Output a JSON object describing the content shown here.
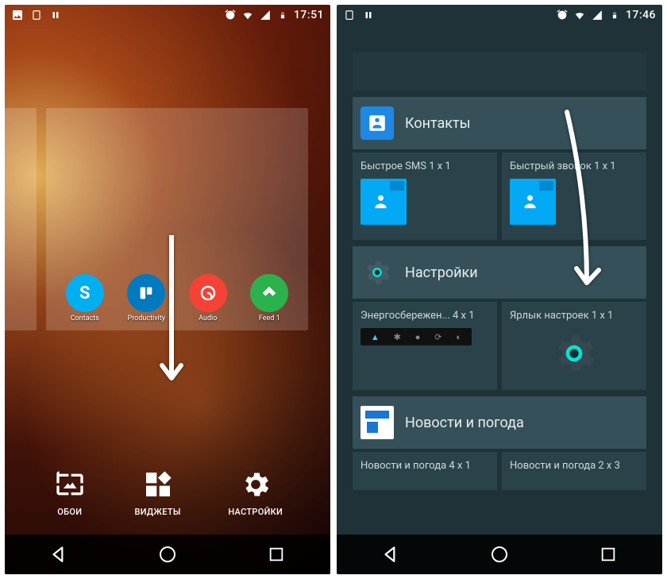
{
  "left": {
    "status": {
      "time": "17:51"
    },
    "apps": [
      {
        "label": "Contacts",
        "bg": "#00aff0",
        "letter": "S"
      },
      {
        "label": "Productivity",
        "bg": "#0079bf",
        "letter": ""
      },
      {
        "label": "Audio",
        "bg": "#f44336",
        "letter": ""
      },
      {
        "label": "Feed 1",
        "bg": "#2bb24c",
        "letter": ""
      }
    ],
    "actions": {
      "wallpaper": "ОБОИ",
      "widgets": "ВИДЖЕТЫ",
      "settings": "НАСТРОЙКИ"
    }
  },
  "right": {
    "status": {
      "time": "17:46"
    },
    "sections": {
      "contacts": {
        "title": "Контакты",
        "sms": "Быстрое SMS  1 x 1",
        "call": "Быстрый звонок  1 x 1"
      },
      "settings": {
        "title": "Настройки",
        "power": "Энергосбережен...  4 x 1",
        "shortcut": "Ярлык настроек  1 x 1"
      },
      "news": {
        "title": "Новости и погода",
        "w1": "Новости и погода  4 x 1",
        "w2": "Новости и погода  2 x 3"
      }
    }
  }
}
